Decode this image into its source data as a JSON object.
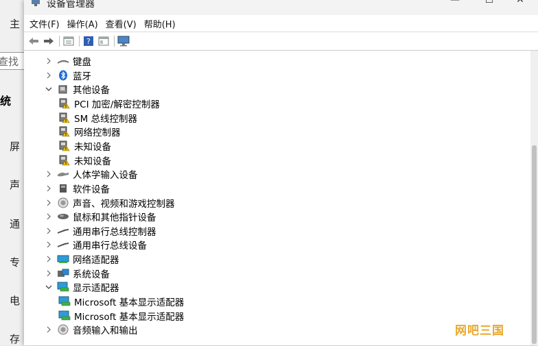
{
  "background": {
    "labels": [
      "主",
      "屏",
      "声",
      "通",
      "专",
      "电",
      "存"
    ],
    "search_text": "查找设",
    "bold_text": "统"
  },
  "window": {
    "title": "设备管理器",
    "controls": {
      "minimize": "—",
      "maximize": "☐",
      "close": "✕"
    }
  },
  "menu": [
    "文件(F)",
    "操作(A)",
    "查看(V)",
    "帮助(H)"
  ],
  "tree": [
    {
      "label": "键盘",
      "expanded": false,
      "level": 0,
      "icon": "keyboard-icon"
    },
    {
      "label": "蓝牙",
      "expanded": false,
      "level": 0,
      "icon": "bluetooth-icon"
    },
    {
      "label": "其他设备",
      "expanded": true,
      "level": 0,
      "icon": "unknown-device-icon"
    },
    {
      "label": "PCI 加密/解密控制器",
      "level": 1,
      "icon": "warning-device-icon"
    },
    {
      "label": "SM 总线控制器",
      "level": 1,
      "icon": "warning-device-icon"
    },
    {
      "label": "网络控制器",
      "level": 1,
      "icon": "warning-device-icon"
    },
    {
      "label": "未知设备",
      "level": 1,
      "icon": "warning-device-icon"
    },
    {
      "label": "未知设备",
      "level": 1,
      "icon": "warning-device-icon"
    },
    {
      "label": "人体学输入设备",
      "expanded": false,
      "level": 0,
      "icon": "hid-icon"
    },
    {
      "label": "软件设备",
      "expanded": false,
      "level": 0,
      "icon": "software-device-icon"
    },
    {
      "label": "声音、视频和游戏控制器",
      "expanded": false,
      "level": 0,
      "icon": "speaker-icon"
    },
    {
      "label": "鼠标和其他指针设备",
      "expanded": false,
      "level": 0,
      "icon": "mouse-icon"
    },
    {
      "label": "通用串行总线控制器",
      "expanded": false,
      "level": 0,
      "icon": "usb-icon"
    },
    {
      "label": "通用串行总线设备",
      "expanded": false,
      "level": 0,
      "icon": "usb-icon"
    },
    {
      "label": "网络适配器",
      "expanded": false,
      "level": 0,
      "icon": "network-adapter-icon"
    },
    {
      "label": "系统设备",
      "expanded": false,
      "level": 0,
      "icon": "system-device-icon"
    },
    {
      "label": "显示适配器",
      "expanded": true,
      "level": 0,
      "icon": "display-adapter-icon"
    },
    {
      "label": "Microsoft 基本显示适配器",
      "level": 1,
      "icon": "display-adapter-icon"
    },
    {
      "label": "Microsoft 基本显示适配器",
      "level": 1,
      "icon": "display-adapter-icon"
    },
    {
      "label": "音频输入和输出",
      "expanded": false,
      "level": 0,
      "icon": "audio-io-icon"
    }
  ],
  "watermark": "网吧三国"
}
